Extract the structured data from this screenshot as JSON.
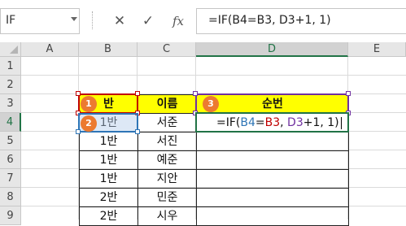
{
  "formula_bar": {
    "name_box": "IF",
    "cancel_icon": "✕",
    "enter_icon": "✓",
    "fx_label": "fx",
    "formula": "=IF(B4=B3, D3+1, 1)"
  },
  "columns": [
    "A",
    "B",
    "C",
    "D",
    "E"
  ],
  "rows": [
    "1",
    "2",
    "3",
    "4",
    "5",
    "6",
    "7",
    "8",
    "9"
  ],
  "headers": {
    "b": "반",
    "c": "이름",
    "d": "순번"
  },
  "data_rows": [
    {
      "b": "1반",
      "c": "서준"
    },
    {
      "b": "1반",
      "c": "서진"
    },
    {
      "b": "1반",
      "c": "예준"
    },
    {
      "b": "1반",
      "c": "지안"
    },
    {
      "b": "2반",
      "c": "민준"
    },
    {
      "b": "2반",
      "c": "시우"
    }
  ],
  "edit_formula": {
    "prefix": "=IF(",
    "ref1": "B4",
    "eq": "=",
    "ref2": "B3",
    "sep": ", ",
    "ref3": "D3",
    "suffix": "+1, 1)"
  },
  "badges": [
    "1",
    "2",
    "3"
  ],
  "colors": {
    "header_fill": "#ffff00",
    "badge": "#ec7a30",
    "red_ref": "#c00000",
    "blue_ref": "#2e75b6",
    "purple_ref": "#7030a0",
    "excel_green": "#217346"
  }
}
